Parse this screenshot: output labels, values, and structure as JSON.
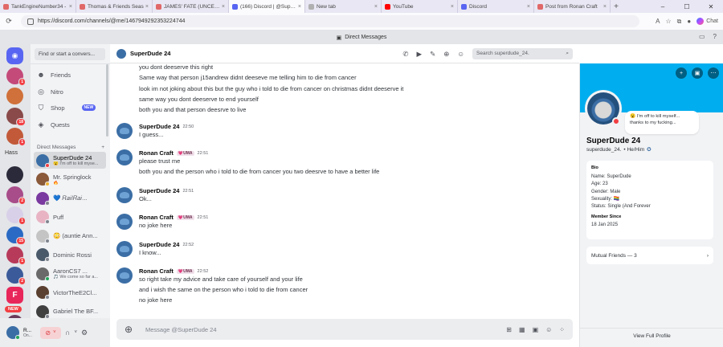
{
  "browser": {
    "tabs": [
      {
        "label": "TankEngineNumber34 -",
        "color": "#e06868"
      },
      {
        "label": "Thomas & Friends Seas",
        "color": "#e06868"
      },
      {
        "label": "JAMES' FATE (UNCENSO",
        "color": "#e06868"
      },
      {
        "label": "(166) Discord | @SuperD",
        "color": "#5865f2"
      },
      {
        "label": "New tab",
        "color": "#b0b0b0"
      },
      {
        "label": "YouTube",
        "color": "#ff0000"
      },
      {
        "label": "Discord",
        "color": "#5865f2"
      },
      {
        "label": "Post from Ronan Craft",
        "color": "#e06868"
      }
    ],
    "url": "https://discord.com/channels/@me/1467949292353224744",
    "copilot_label": "Chat"
  },
  "discord": {
    "top_title": "Direct Messages",
    "find_placeholder": "Find or start a convers...",
    "nav": {
      "friends": "Friends",
      "nitro": "Nitro",
      "shop": "Shop",
      "shop_badge": "NEW",
      "quests": "Quests"
    },
    "dm_header": "Direct Messages",
    "dm_header_plus": "+",
    "dms": [
      {
        "name": "SuperDude 24",
        "sub": "😮 I'm off to kill myse...",
        "color": "#3b6ea5",
        "status": "#f23f43"
      },
      {
        "name": "Mr. Springlock",
        "sub": "🔥",
        "color": "#8a5a3a",
        "status": "#f0b232"
      },
      {
        "name": "💙 𝑅𝑎𝑖𝑙𝑅𝑎𝑖...",
        "sub": "",
        "color": "#7a3aa0",
        "status": "#80848e"
      },
      {
        "name": "Puff",
        "sub": "",
        "color": "#e8b4c4",
        "status": "#80848e"
      },
      {
        "name": "😳 (auntie Ann...",
        "sub": "",
        "color": "#c4c4c4",
        "status": "#80848e"
      },
      {
        "name": "Dominic Rossi",
        "sub": "",
        "color": "#4a5a6a",
        "status": "#80848e"
      },
      {
        "name": "AaronCS7 ...",
        "sub": "🎵 We come so far a...",
        "color": "#6a6a6a",
        "status": "#23a55a"
      },
      {
        "name": "VictorTheE2Cl...",
        "sub": "",
        "color": "#5a4030",
        "status": "#80848e"
      },
      {
        "name": "Gabriel The BF...",
        "sub": "",
        "color": "#404040",
        "status": "#80848e"
      }
    ],
    "servers": {
      "hass_label": "Hass",
      "new_label": "NEW",
      "badges": [
        "1",
        "18",
        "1",
        "2",
        "1",
        "15",
        "1",
        "2"
      ]
    },
    "user": {
      "name": "R...",
      "status": "On..."
    },
    "chat": {
      "header_name": "SuperDude 24",
      "search_placeholder": "Search superdude_24.",
      "top_lines": [
        "you dont deeserve this right",
        "Same way that person j15andrew didnt deeseve me telling him to die from cancer",
        "look im not joking about this but the guy who i told to die from cancer on christmas didnt deeserve it",
        "same way you dont deeserve to end yourself",
        "both you and that person deesrve to live"
      ],
      "groups": [
        {
          "name": "SuperDude 24",
          "tag": "",
          "time": "22:50",
          "lines": [
            "I guess..."
          ]
        },
        {
          "name": "Ronan Craft",
          "tag": "💗UMA",
          "time": "22:51",
          "lines": [
            "please trust me",
            "both you and the person who i told to die from cancer you two deesrve to have a better life"
          ]
        },
        {
          "name": "SuperDude 24",
          "tag": "",
          "time": "22:51",
          "lines": [
            "Ok..."
          ]
        },
        {
          "name": "Ronan Craft",
          "tag": "💗UMA",
          "time": "22:51",
          "lines": [
            "no joke here"
          ]
        },
        {
          "name": "SuperDude 24",
          "tag": "",
          "time": "22:52",
          "lines": [
            "I know..."
          ]
        },
        {
          "name": "Ronan Craft",
          "tag": "💗UMA",
          "time": "22:52",
          "lines": [
            "so right take my advice and take care of yourself and your life",
            "and i wish the same on the person who i told to die from cancer",
            "no joke here"
          ]
        }
      ],
      "composer_placeholder": "Message @SuperDude 24"
    },
    "profile": {
      "banner_color": "#00aeef",
      "bubble_lines": [
        "😮 I'm off to kill myself...",
        "thanks to my fucking..."
      ],
      "display_name": "SuperDude 24",
      "username": "superdude_24.",
      "pronouns": "• He/Him",
      "bio_heading": "Bio",
      "bio_lines": [
        "Name: SuperDude",
        "Age: 23",
        "Gender: Male",
        "Sexuality: 🏳️‍🌈",
        "Status: Single (And Forever"
      ],
      "member_since_heading": "Member Since",
      "member_since": "18 Jan 2025",
      "mutual_friends": "Mutual Friends — 3",
      "view_full": "View Full Profile"
    }
  }
}
